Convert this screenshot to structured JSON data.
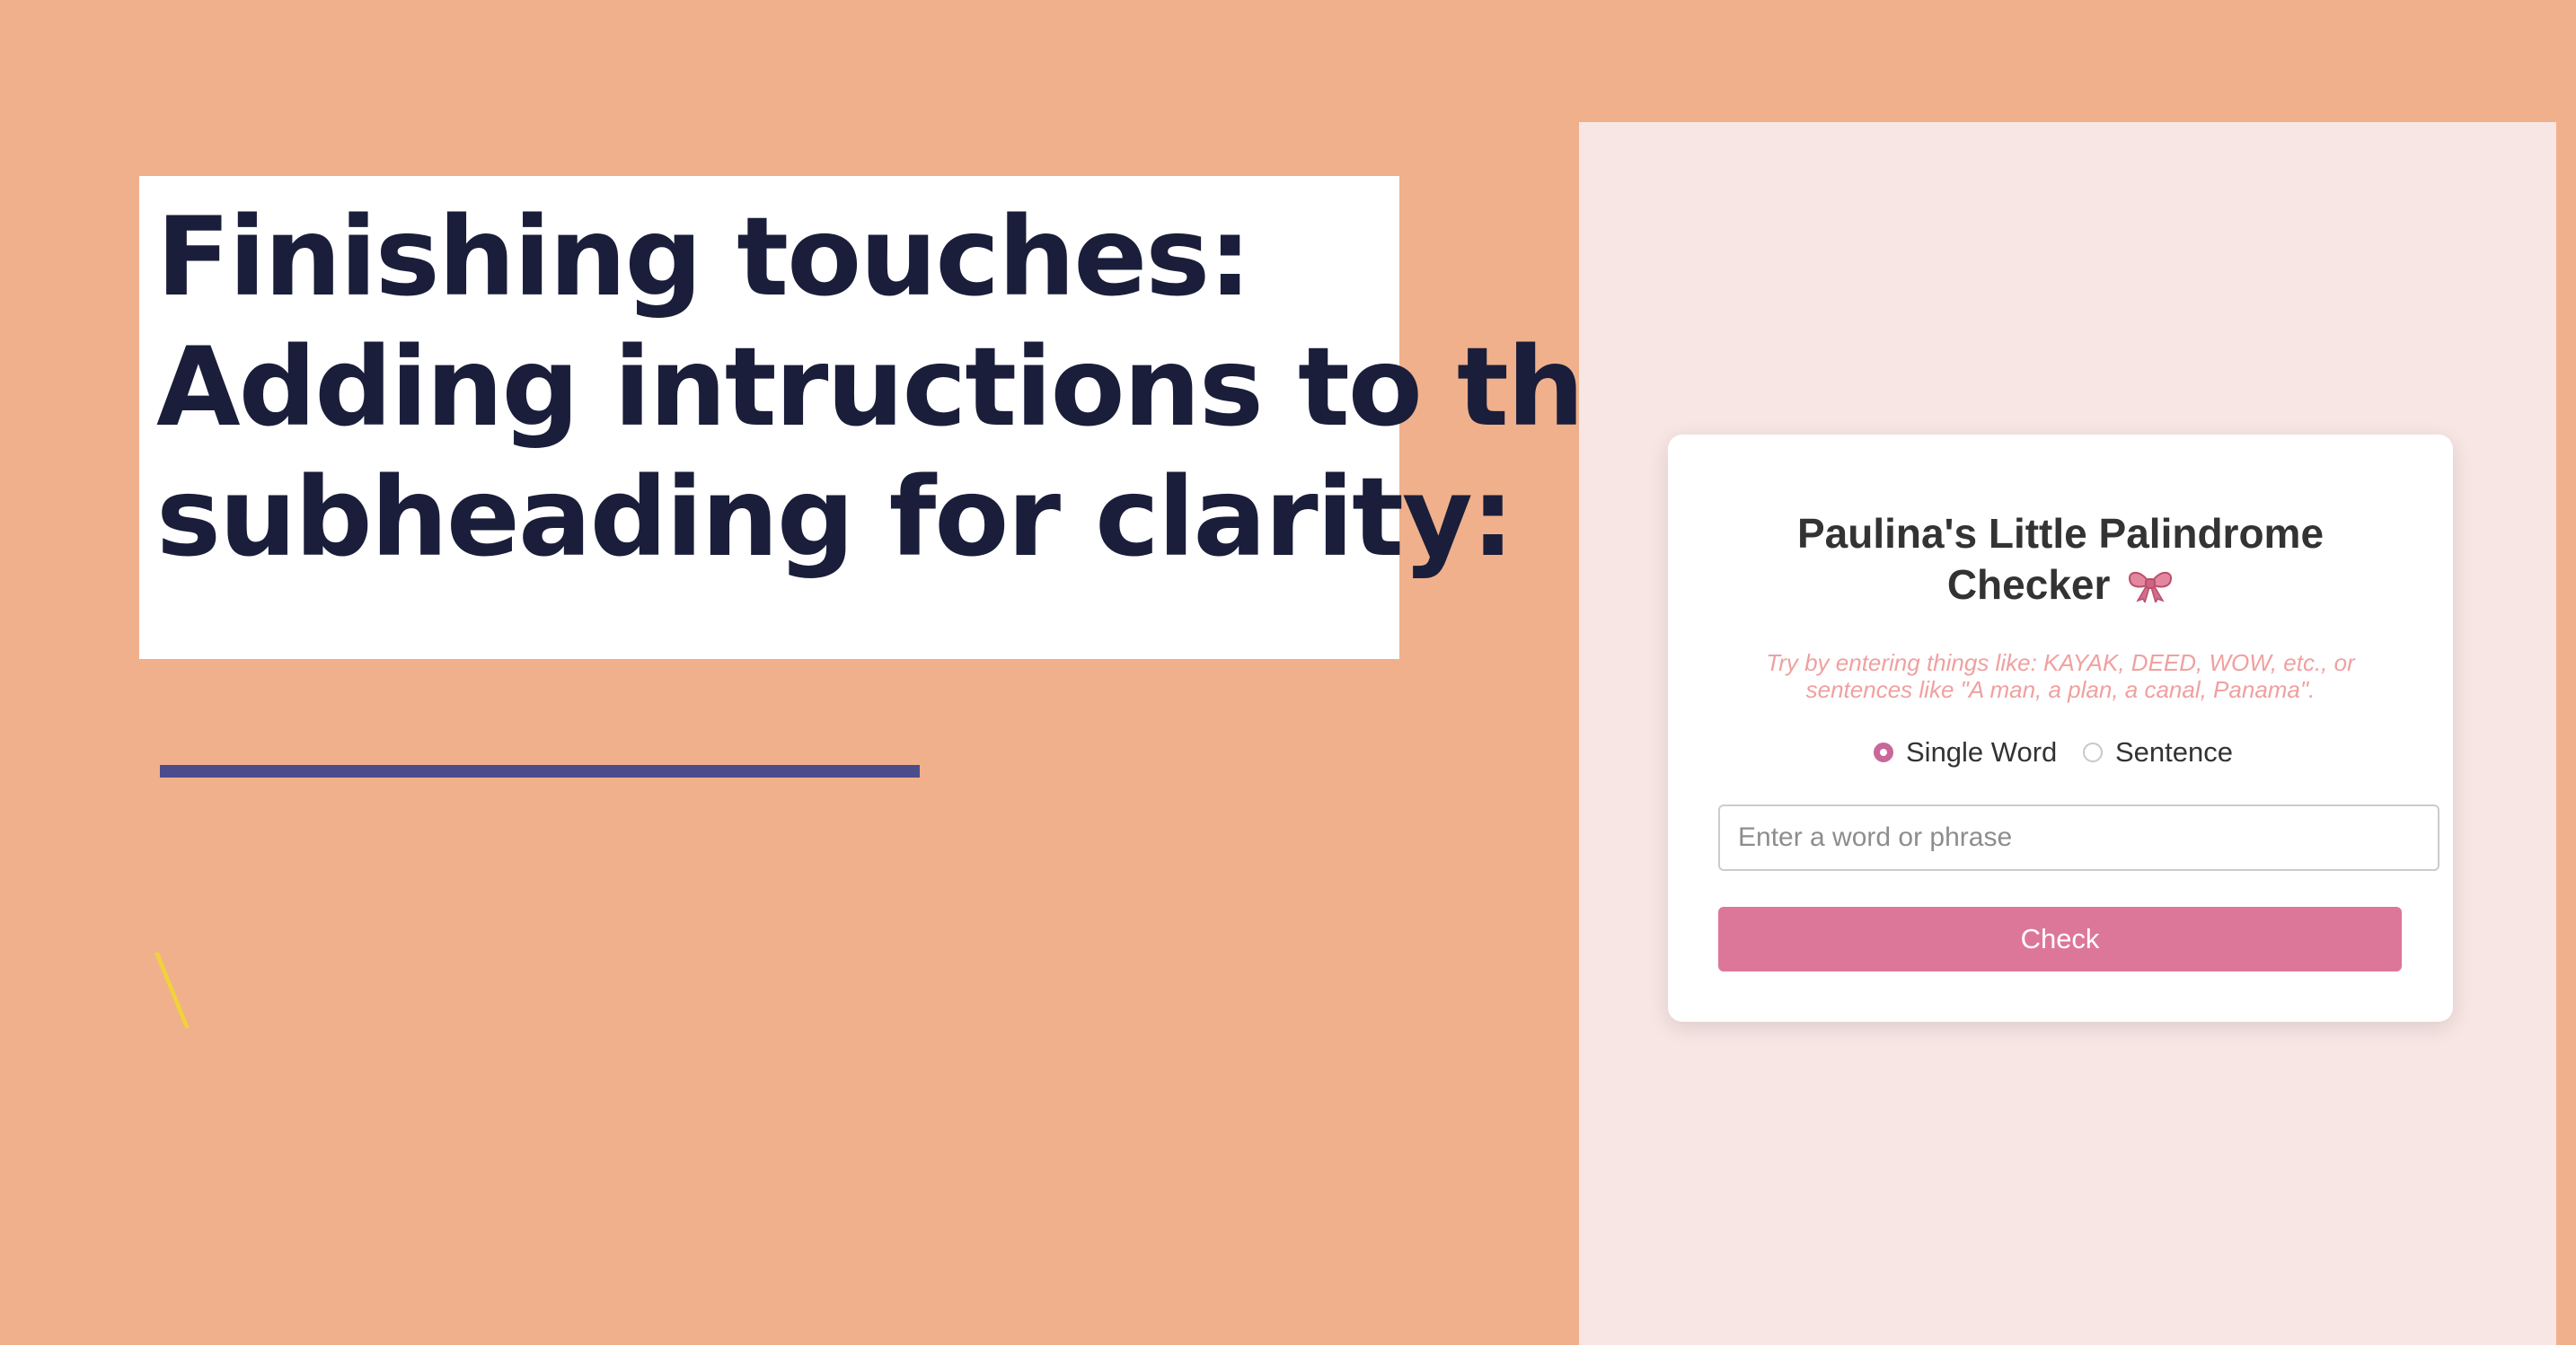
{
  "slide": {
    "title_lines": [
      "Finishing touches:",
      "Adding intructions to the",
      "subheading for clarity:"
    ],
    "stray_mark": "\\"
  },
  "checker": {
    "title_line1": "Paulina's Little Palindrome",
    "title_line2": "Checker",
    "title_icon": "ribbon-bow-icon",
    "instructions": "Try by entering things like: KAYAK, DEED, WOW, etc., or sentences like \"A man, a plan, a canal, Panama\".",
    "modes": [
      {
        "label": "Single Word",
        "selected": true
      },
      {
        "label": "Sentence",
        "selected": false
      }
    ],
    "input": {
      "placeholder": "Enter a word or phrase",
      "value": ""
    },
    "check_label": "Check"
  },
  "colors": {
    "slide_background": "#f0b08b",
    "title_box": "#ffffff",
    "title_text": "#1a1e3a",
    "accent_bar": "#4b4c8c",
    "stray_mark": "#f2d13b",
    "preview_background": "#f8e6e4",
    "instructions_text": "#f0a0a0",
    "radio_selected": "#c8689a",
    "button_background": "#dd7799",
    "button_text": "#ffffff"
  }
}
